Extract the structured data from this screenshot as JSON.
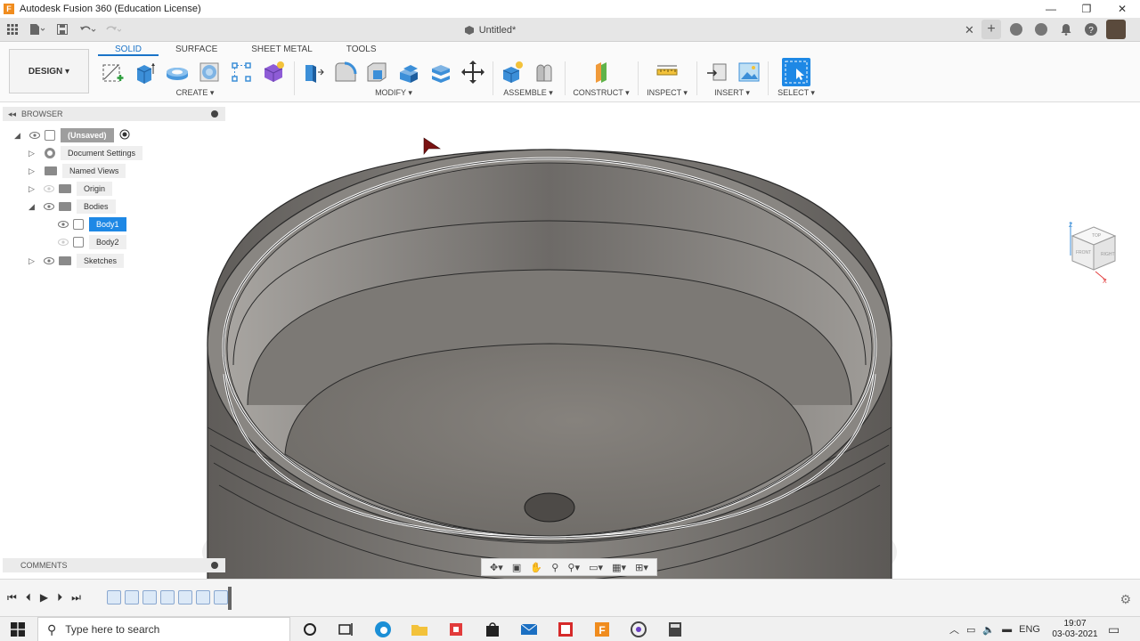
{
  "window": {
    "title": "Autodesk Fusion 360 (Education License)",
    "logo_letter": "F",
    "minimize": "—",
    "restore": "❐",
    "close": "✕"
  },
  "document": {
    "tab_title": "Untitled*",
    "close": "✕"
  },
  "ribbon": {
    "workspace_button": "DESIGN ▾",
    "tabs": [
      {
        "label": "SOLID",
        "active": true
      },
      {
        "label": "SURFACE",
        "active": false
      },
      {
        "label": "SHEET METAL",
        "active": false
      },
      {
        "label": "TOOLS",
        "active": false
      }
    ],
    "groups": {
      "create": "CREATE ▾",
      "modify": "MODIFY ▾",
      "assemble": "ASSEMBLE ▾",
      "construct": "CONSTRUCT ▾",
      "inspect": "INSPECT ▾",
      "insert": "INSERT ▾",
      "select": "SELECT ▾"
    }
  },
  "browser": {
    "title": "BROWSER",
    "root": "(Unsaved)",
    "items": [
      {
        "label": "Document Settings"
      },
      {
        "label": "Named Views"
      },
      {
        "label": "Origin"
      },
      {
        "label": "Bodies"
      },
      {
        "label": "Body1",
        "selected": true
      },
      {
        "label": "Body2"
      },
      {
        "label": "Sketches"
      }
    ]
  },
  "comments": {
    "title": "COMMENTS"
  },
  "viewcube": {
    "faces": [
      "TOP",
      "FRONT",
      "RIGHT"
    ],
    "axes": [
      "Z",
      "X"
    ]
  },
  "taskbar": {
    "search_placeholder": "Type here to search",
    "language": "ENG",
    "time": "19:07",
    "date": "03-03-2021"
  },
  "colors": {
    "accent": "#1e88e5",
    "model_gray": "#6e6b68",
    "fusion_orange": "#f08c1e"
  }
}
